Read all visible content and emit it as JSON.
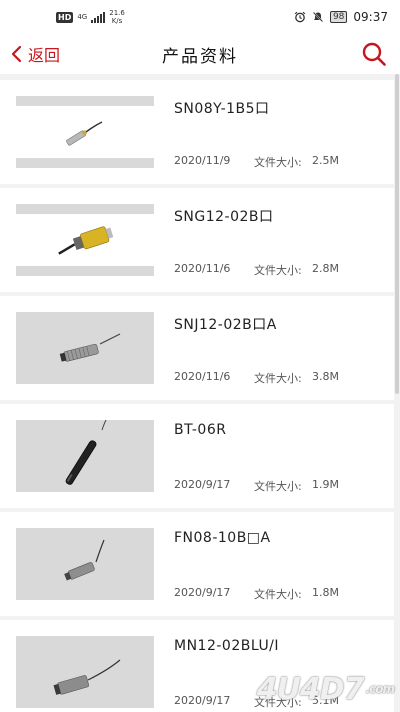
{
  "status_bar": {
    "hd": "HD",
    "net": "4G",
    "speed_value": "21.6",
    "speed_unit": "K/s",
    "battery": "98",
    "time": "09:37"
  },
  "nav": {
    "back_label": "返回",
    "title": "产品资料"
  },
  "size_label": "文件大小:",
  "products": [
    {
      "model": "SN08Y-1B5口",
      "date": "2020/11/9",
      "size": "2.5M"
    },
    {
      "model": "SNG12-02B口",
      "date": "2020/11/6",
      "size": "2.8M"
    },
    {
      "model": "SNJ12-02B口A",
      "date": "2020/11/6",
      "size": "3.8M"
    },
    {
      "model": "BT-06R",
      "date": "2020/9/17",
      "size": "1.9M"
    },
    {
      "model": "FN08-10B□A",
      "date": "2020/9/17",
      "size": "1.8M"
    },
    {
      "model": "MN12-02BLU/I",
      "date": "2020/9/17",
      "size": "5.1M"
    }
  ],
  "watermark": {
    "text": "4U4D7",
    "suffix": ".com"
  },
  "colors": {
    "accent": "#c8161e",
    "background": "#f2f2f2"
  }
}
